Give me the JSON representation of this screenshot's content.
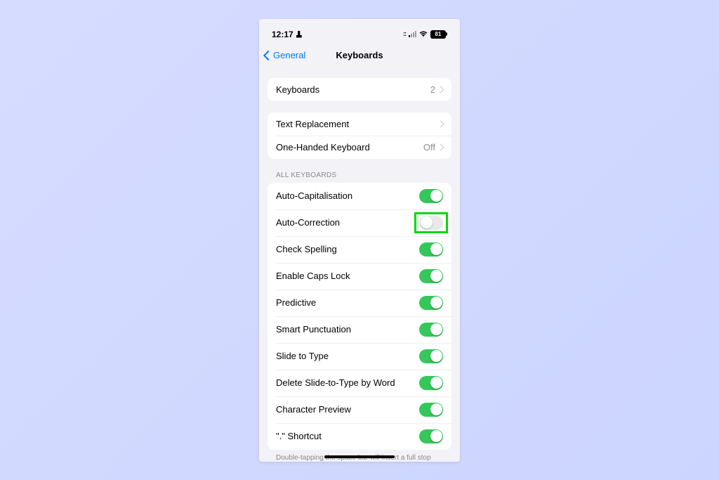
{
  "status": {
    "time": "12:17",
    "battery_pct": "81"
  },
  "nav": {
    "back_label": "General",
    "title": "Keyboards"
  },
  "group1": {
    "keyboards_label": "Keyboards",
    "keyboards_count": "2"
  },
  "group2": {
    "text_replacement": "Text Replacement",
    "one_handed_label": "One-Handed Keyboard",
    "one_handed_value": "Off"
  },
  "section_header": "ALL KEYBOARDS",
  "toggles": [
    {
      "label": "Auto-Capitalisation",
      "on": true,
      "highlighted": false
    },
    {
      "label": "Auto-Correction",
      "on": false,
      "highlighted": true
    },
    {
      "label": "Check Spelling",
      "on": true,
      "highlighted": false
    },
    {
      "label": "Enable Caps Lock",
      "on": true,
      "highlighted": false
    },
    {
      "label": "Predictive",
      "on": true,
      "highlighted": false
    },
    {
      "label": "Smart Punctuation",
      "on": true,
      "highlighted": false
    },
    {
      "label": "Slide to Type",
      "on": true,
      "highlighted": false
    },
    {
      "label": "Delete Slide-to-Type by Word",
      "on": true,
      "highlighted": false
    },
    {
      "label": "Character Preview",
      "on": true,
      "highlighted": false
    },
    {
      "label": "\".\" Shortcut",
      "on": true,
      "highlighted": false
    }
  ],
  "footer": "Double-tapping the space bar will insert a full stop followed by a space."
}
